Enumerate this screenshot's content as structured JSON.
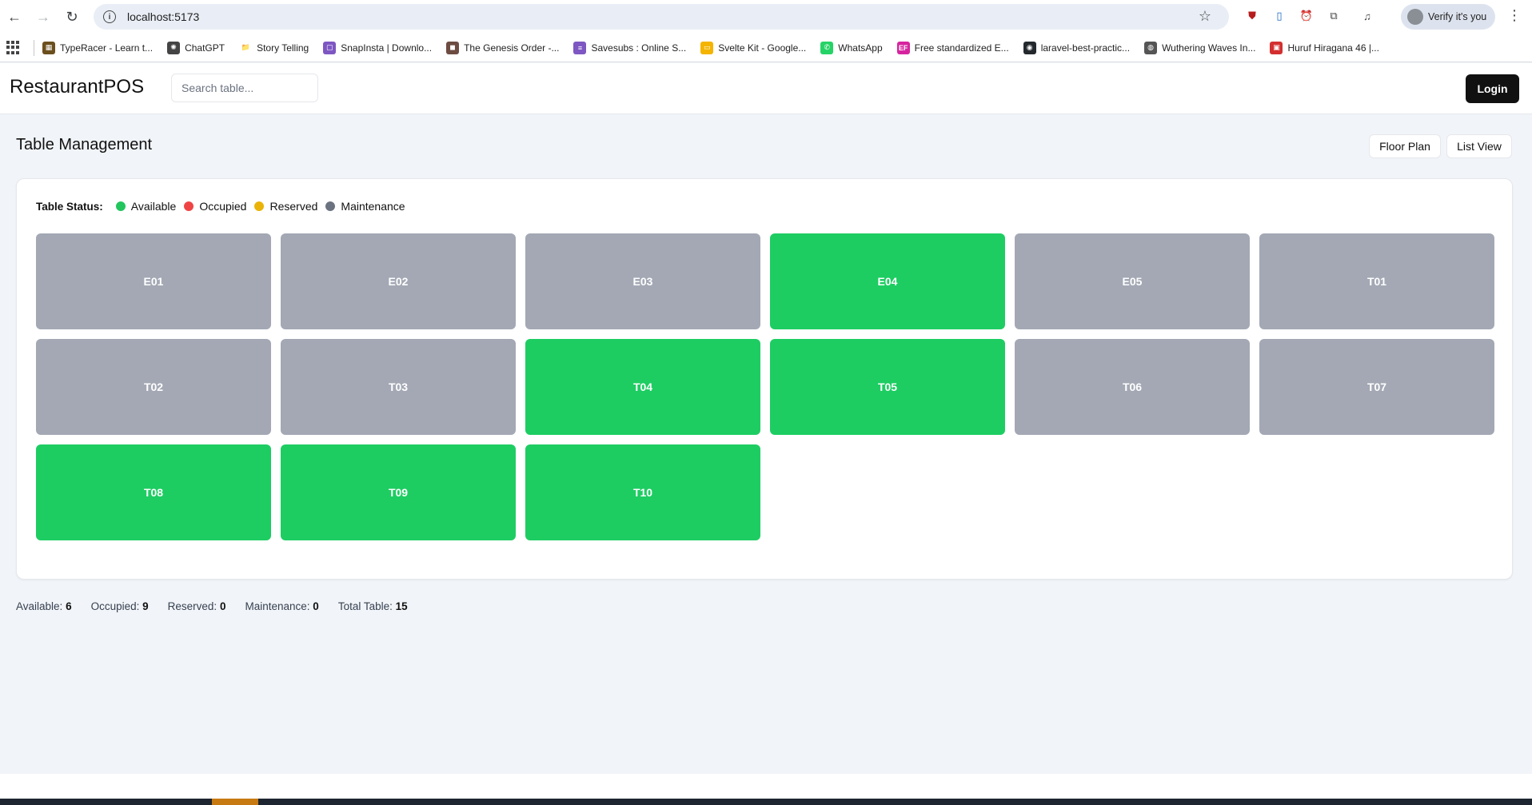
{
  "browser": {
    "url": "localhost:5173",
    "profile_label": "Verify it's you",
    "bookmarks": [
      {
        "label": "TypeRacer - Learn t...",
        "color": "#6b4f1d",
        "glyph": "▦"
      },
      {
        "label": "ChatGPT",
        "color": "#444444",
        "glyph": "✺"
      },
      {
        "label": "Story Telling",
        "color": "#ffffff",
        "glyph": "📁"
      },
      {
        "label": "SnapInsta | Downlo...",
        "color": "#7e57c2",
        "glyph": "▢"
      },
      {
        "label": "The Genesis Order -...",
        "color": "#6d4c41",
        "glyph": "◼"
      },
      {
        "label": "Savesubs : Online S...",
        "color": "#7e57c2",
        "glyph": "≡"
      },
      {
        "label": "Svelte Kit - Google...",
        "color": "#f4b400",
        "glyph": "▭"
      },
      {
        "label": "WhatsApp",
        "color": "#25d366",
        "glyph": "✆"
      },
      {
        "label": "Free standardized E...",
        "color": "#d6249f",
        "glyph": "EF"
      },
      {
        "label": "laravel-best-practic...",
        "color": "#24292e",
        "glyph": "◉"
      },
      {
        "label": "Wuthering Waves In...",
        "color": "#555555",
        "glyph": "◍"
      },
      {
        "label": "Huruf Hiragana 46 |...",
        "color": "#d32f2f",
        "glyph": "▣"
      }
    ]
  },
  "header": {
    "brand": "RestaurantPOS",
    "search_placeholder": "Search table...",
    "login_label": "Login"
  },
  "page": {
    "title": "Table Management",
    "floor_plan_label": "Floor Plan",
    "list_view_label": "List View"
  },
  "legend": {
    "title": "Table Status:",
    "items": [
      {
        "label": "Available",
        "color": "#22c55e"
      },
      {
        "label": "Occupied",
        "color": "#ef4444"
      },
      {
        "label": "Reserved",
        "color": "#eab308"
      },
      {
        "label": "Maintenance",
        "color": "#6b7280"
      }
    ]
  },
  "status_colors": {
    "available": "#1dcd62",
    "inactive": "#a3a8b4"
  },
  "tables": [
    {
      "id": "E01",
      "state": "inactive"
    },
    {
      "id": "E02",
      "state": "inactive"
    },
    {
      "id": "E03",
      "state": "inactive"
    },
    {
      "id": "E04",
      "state": "available"
    },
    {
      "id": "E05",
      "state": "inactive"
    },
    {
      "id": "T01",
      "state": "inactive"
    },
    {
      "id": "T02",
      "state": "inactive"
    },
    {
      "id": "T03",
      "state": "inactive"
    },
    {
      "id": "T04",
      "state": "available"
    },
    {
      "id": "T05",
      "state": "available"
    },
    {
      "id": "T06",
      "state": "inactive"
    },
    {
      "id": "T07",
      "state": "inactive"
    },
    {
      "id": "T08",
      "state": "available"
    },
    {
      "id": "T09",
      "state": "available"
    },
    {
      "id": "T10",
      "state": "available"
    }
  ],
  "summary": {
    "available_label": "Available:",
    "available": "6",
    "occupied_label": "Occupied:",
    "occupied": "9",
    "reserved_label": "Reserved:",
    "reserved": "0",
    "maintenance_label": "Maintenance:",
    "maintenance": "0",
    "total_label": "Total Table:",
    "total": "15"
  }
}
